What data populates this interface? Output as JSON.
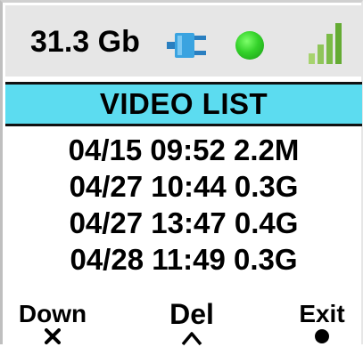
{
  "status": {
    "storage_label": "31.3 Gb",
    "icons": [
      "power-plug-icon",
      "status-led-icon",
      "signal-strength-icon"
    ],
    "led_color": "#34d22a",
    "plug_color": "#3aa3e0",
    "signal_color": "#6bb03a"
  },
  "header": {
    "title": "VIDEO LIST",
    "background": "#5cdcf0"
  },
  "videos": [
    {
      "label": "04/15 09:52 2.2M"
    },
    {
      "label": "04/27 10:44 0.3G"
    },
    {
      "label": "04/27 13:47 0.4G"
    },
    {
      "label": "04/28 11:49 0.3G"
    }
  ],
  "softkeys": {
    "left": {
      "label": "Down",
      "icon": "cross-icon"
    },
    "center": {
      "label": "Del",
      "icon": "triangle-up-icon"
    },
    "right": {
      "label": "Exit",
      "icon": "circle-icon"
    }
  }
}
